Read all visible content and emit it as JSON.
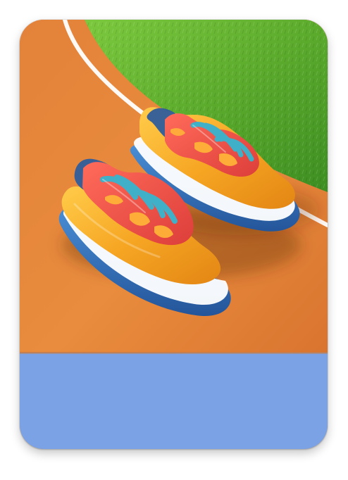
{
  "card": {
    "item_icon": "running-shoes-icon",
    "caption_text": ""
  },
  "colors": {
    "track": "#e6883a",
    "grass": "#5fae2e",
    "lane_line": "#ffffff",
    "shoe_body": "#f6a623",
    "shoe_overlay": "#ef5a4a",
    "laces": "#3fb0c8",
    "sole": "#2f6fb8",
    "caption_band": "#7ba2e4"
  }
}
